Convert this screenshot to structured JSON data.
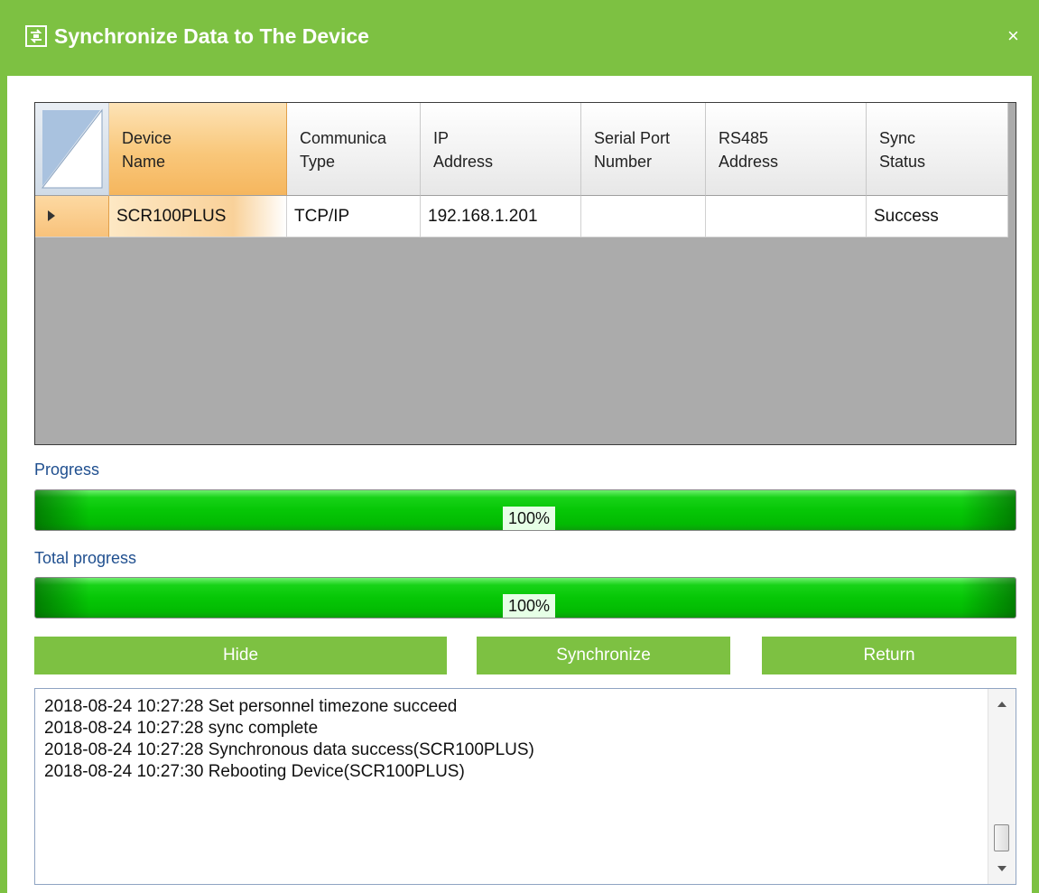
{
  "window": {
    "title": "Synchronize Data to The Device",
    "title_icon": "sync-device-icon",
    "close_icon": "close-icon",
    "close_glyph": "×",
    "accent_color": "#7dc142"
  },
  "grid": {
    "columns": [
      {
        "label": "Device\nName"
      },
      {
        "label": "Communica\nType"
      },
      {
        "label": "IP\nAddress"
      },
      {
        "label": "Serial Port\nNumber"
      },
      {
        "label": "RS485\nAddress"
      },
      {
        "label": "Sync\nStatus"
      }
    ],
    "rows": [
      {
        "device_name": "SCR100PLUS",
        "comm_type": "TCP/IP",
        "ip": "192.168.1.201",
        "serial_port": "",
        "rs485": "",
        "status": "Success"
      }
    ]
  },
  "progress": {
    "label": "Progress",
    "value_text": "100%",
    "fraction": 1.0
  },
  "total_progress": {
    "label": "Total progress",
    "value_text": "100%",
    "fraction": 1.0
  },
  "buttons": {
    "hide": "Hide",
    "synchronize": "Synchronize",
    "return": "Return"
  },
  "log": {
    "lines": [
      "2018-08-24 10:27:28 Set personnel timezone succeed",
      "2018-08-24 10:27:28 sync complete",
      "2018-08-24 10:27:28 Synchronous data success(SCR100PLUS)",
      "2018-08-24 10:27:30 Rebooting Device(SCR100PLUS)"
    ]
  }
}
